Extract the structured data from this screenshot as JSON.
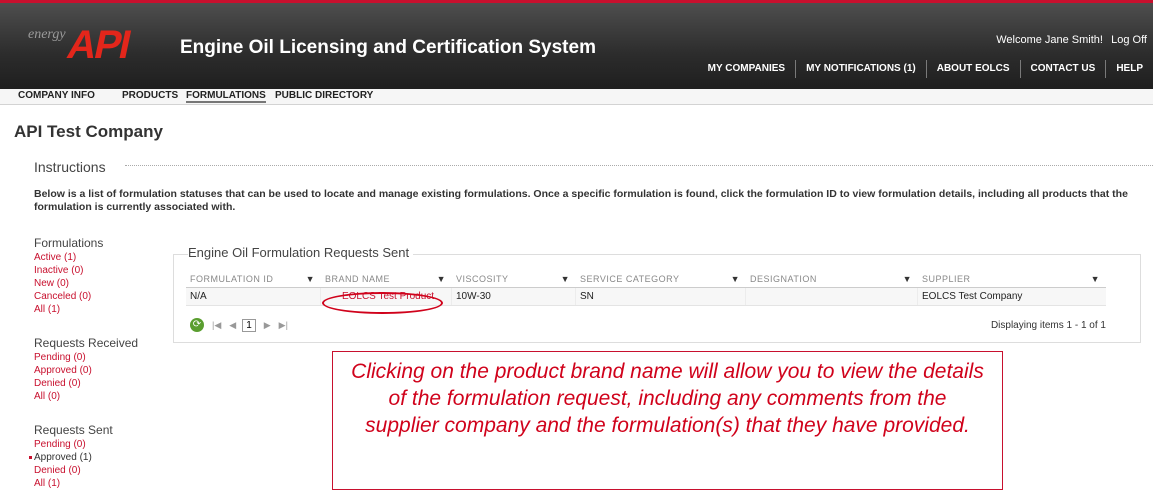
{
  "header": {
    "logo_small": "energy",
    "logo_main": "API",
    "title": "Engine Oil Licensing and Certification System",
    "welcome": "Welcome Jane Smith!",
    "logoff": "Log Off",
    "nav": [
      "MY COMPANIES",
      "MY NOTIFICATIONS (1)",
      "ABOUT EOLCS",
      "CONTACT US",
      "HELP"
    ]
  },
  "subnav": [
    "COMPANY INFO",
    "PRODUCTS",
    "FORMULATIONS",
    "PUBLIC DIRECTORY"
  ],
  "company_name": "API Test Company",
  "instructions": {
    "title": "Instructions",
    "text": "Below is a list of formulation statuses that can be used to locate and manage existing formulations. Once a specific formulation is found, click the formulation ID to view formulation details, including all products that the formulation is currently associated with."
  },
  "sidebar": {
    "formulations": {
      "title": "Formulations",
      "items": [
        "Active (1)",
        "Inactive (0)",
        "New (0)",
        "Canceled (0)",
        "All (1)"
      ]
    },
    "received": {
      "title": "Requests Received",
      "items": [
        "Pending (0)",
        "Approved (0)",
        "Denied (0)",
        "All (0)"
      ]
    },
    "sent": {
      "title": "Requests Sent",
      "items": [
        "Pending (0)",
        "Approved (1)",
        "Denied (0)",
        "All (1)"
      ]
    }
  },
  "grid": {
    "title": "Engine Oil Formulation Requests Sent",
    "columns": [
      "FORMULATION ID",
      "BRAND NAME",
      "VISCOSITY",
      "SERVICE CATEGORY",
      "DESIGNATION",
      "SUPPLIER"
    ],
    "rows": [
      [
        "N/A",
        "EOLCS Test Product",
        "10W-30",
        "SN",
        "",
        "EOLCS Test Company"
      ]
    ],
    "pager": {
      "page": "1",
      "display": "Displaying items 1 - 1 of 1",
      "filter_icon": "filter-icon"
    }
  },
  "callout": "Clicking on the product brand name will allow you to view the details of the formulation request, including any comments from the supplier company and the formulation(s) that they have provided.",
  "colors": {
    "accent": "#c8102e",
    "header_bg": "#2c2c2c"
  }
}
